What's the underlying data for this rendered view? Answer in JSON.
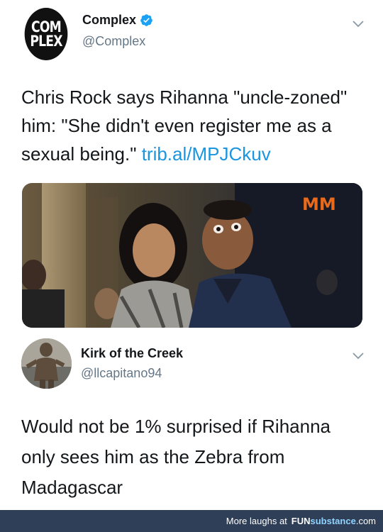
{
  "tweet1": {
    "avatar_line1": "COM",
    "avatar_line2": "PLEX",
    "display_name": "Complex",
    "handle": "@Complex",
    "text": "Chris Rock says Rihanna \"uncle-zoned\" him: \"She didn't even register me as a sexual being.\" ",
    "link": "trib.al/MPJCkuv",
    "photo_annotation": "MM",
    "icons": {
      "verified": "verified-badge-icon",
      "menu": "chevron-down-icon"
    }
  },
  "tweet2": {
    "display_name": "Kirk of the Creek",
    "handle": "@llcapitano94",
    "text": "Would not be 1% surprised if Rihanna only sees him as the Zebra from Madagascar",
    "icons": {
      "menu": "chevron-down-icon"
    }
  },
  "footer": {
    "prefix": "More laughs at",
    "brand_fun": "FUN",
    "brand_substance": "substance",
    "brand_tld": ".com"
  },
  "colors": {
    "link": "#1b95e0",
    "verified": "#1da1f2",
    "footer_bg": "#2f3f57",
    "handle": "#657786"
  }
}
